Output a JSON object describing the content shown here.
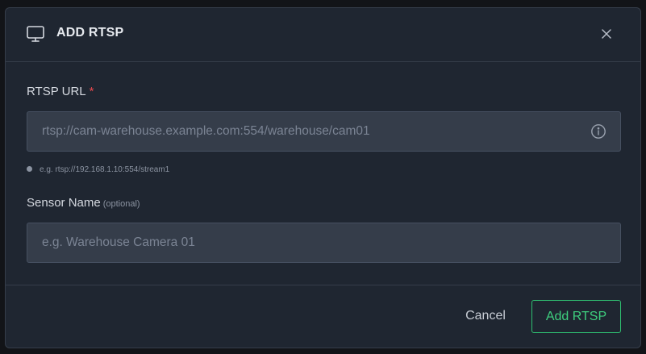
{
  "dialog": {
    "title": "ADD RTSP",
    "header_icon": "monitor-icon",
    "close_icon": "close-icon"
  },
  "rtsp_url": {
    "label": "RTSP URL",
    "required_mark": "*",
    "value": "",
    "placeholder": "rtsp://cam-warehouse.example.com:554/warehouse/cam01",
    "info_icon": "info-icon",
    "hint": "e.g. rtsp://192.168.1.10:554/stream1"
  },
  "sensor_name": {
    "label": "Sensor Name",
    "optional_tag": "(optional)",
    "value": "",
    "placeholder": "e.g. Warehouse Camera 01"
  },
  "footer": {
    "cancel_label": "Cancel",
    "submit_label": "Add RTSP"
  },
  "colors": {
    "dialog_bg": "#1f2631",
    "input_bg": "#353d4a",
    "accent_green": "#3ecf7e",
    "required_red": "#e5484d"
  }
}
